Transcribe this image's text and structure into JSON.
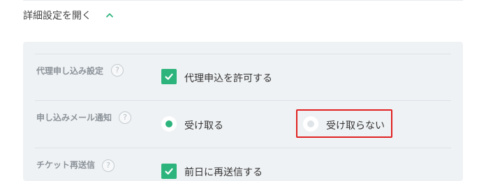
{
  "details_toggle": {
    "label": "詳細設定を開く",
    "icon": "chevron-up-icon"
  },
  "colors": {
    "accent": "#2db37c",
    "highlight": "#e02020",
    "panel": "#eff2f4"
  },
  "rows": [
    {
      "label": "代理申し込み設定",
      "help": "?",
      "option": {
        "type": "checkbox",
        "label": "代理申込を許可する",
        "checked": true
      }
    },
    {
      "label": "申し込みメール通知",
      "help": "?",
      "options": [
        {
          "type": "radio",
          "label": "受け取る",
          "selected": true
        },
        {
          "type": "radio",
          "label": "受け取らない",
          "selected": false
        }
      ]
    },
    {
      "label": "チケット再送信",
      "help": "?",
      "option": {
        "type": "checkbox",
        "label": "前日に再送信する",
        "checked": true
      }
    }
  ]
}
